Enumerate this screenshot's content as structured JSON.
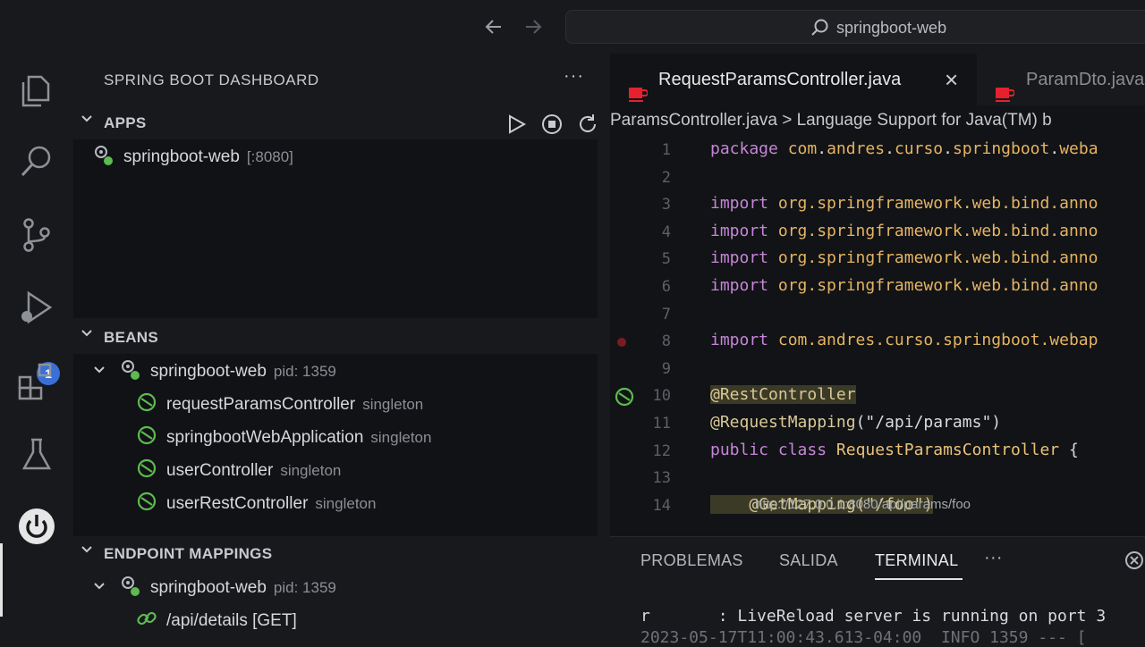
{
  "titlebar": {
    "search_text": "springboot-web",
    "back_icon": "arrow-left-icon",
    "forward_icon": "arrow-right-icon"
  },
  "activity_bar": {
    "items": [
      "files-icon",
      "search-icon",
      "source-control-icon",
      "run-debug-icon",
      "extensions-icon",
      "testing-icon",
      "spring-boot-icon"
    ],
    "debug_badge": "1"
  },
  "sidebar": {
    "title": "SPRING BOOT DASHBOARD",
    "more": "···",
    "apps": {
      "header": "APPS",
      "items": [
        {
          "name": "springboot-web",
          "port": "[:8080]"
        }
      ]
    },
    "beans": {
      "header": "BEANS",
      "app": {
        "name": "springboot-web",
        "pid": "pid: 1359"
      },
      "items": [
        {
          "name": "requestParamsController",
          "scope": "singleton"
        },
        {
          "name": "springbootWebApplication",
          "scope": "singleton"
        },
        {
          "name": "userController",
          "scope": "singleton"
        },
        {
          "name": "userRestController",
          "scope": "singleton"
        }
      ]
    },
    "endpoints": {
      "header": "ENDPOINT MAPPINGS",
      "app": {
        "name": "springboot-web",
        "pid": "pid: 1359"
      },
      "items": [
        {
          "path": "/api/details [GET]"
        }
      ]
    }
  },
  "editor": {
    "tabs": [
      {
        "label": "RequestParamsController.java",
        "close": "×"
      },
      {
        "label": "ParamDto.java"
      }
    ],
    "breadcrumb": "ParamsController.java > Language Support for Java(TM) b",
    "lines": [
      {
        "n": "1",
        "parts": [
          [
            "kw",
            "package "
          ],
          [
            "pkg",
            "com"
          ],
          [
            "str",
            "."
          ],
          [
            "pkg",
            "andres"
          ],
          [
            "str",
            "."
          ],
          [
            "pkg",
            "curso"
          ],
          [
            "str",
            "."
          ],
          [
            "pkg",
            "springboot"
          ],
          [
            "str",
            "."
          ],
          [
            "pkg",
            "weba"
          ]
        ]
      },
      {
        "n": "2",
        "parts": []
      },
      {
        "n": "3",
        "parts": [
          [
            "kw",
            "import "
          ],
          [
            "pkg",
            "org.springframework.web.bind.anno"
          ]
        ]
      },
      {
        "n": "4",
        "parts": [
          [
            "kw",
            "import "
          ],
          [
            "pkg",
            "org.springframework.web.bind.anno"
          ]
        ]
      },
      {
        "n": "5",
        "parts": [
          [
            "kw",
            "import "
          ],
          [
            "pkg",
            "org.springframework.web.bind.anno"
          ]
        ]
      },
      {
        "n": "6",
        "parts": [
          [
            "kw",
            "import "
          ],
          [
            "pkg",
            "org.springframework.web.bind.anno"
          ]
        ]
      },
      {
        "n": "7",
        "parts": []
      },
      {
        "n": "8",
        "parts": [
          [
            "kw",
            "import "
          ],
          [
            "pkg",
            "com.andres.curso.springboot.webap"
          ]
        ]
      },
      {
        "n": "9",
        "parts": []
      },
      {
        "n": "10",
        "parts": [
          [
            "ann hl",
            "@RestController"
          ]
        ]
      },
      {
        "n": "11",
        "parts": [
          [
            "ann",
            "@RequestMapping"
          ],
          [
            "str",
            "(\"/api/params\")"
          ]
        ]
      },
      {
        "n": "12",
        "parts": [
          [
            "kw",
            "public class "
          ],
          [
            "cls",
            "RequestParamsController"
          ],
          [
            "str",
            " {"
          ]
        ]
      },
      {
        "n": "13",
        "parts": []
      },
      {
        "n": "14",
        "parts": [
          [
            "ann hl",
            "    @GetMapping(\"/foo\")"
          ]
        ]
      }
    ],
    "hint": "http://127.0.0.1:8080/api/params/foo"
  },
  "panel": {
    "tabs": [
      "PROBLEMAS",
      "SALIDA",
      "TERMINAL"
    ],
    "active_tab": "TERMINAL",
    "more": "···",
    "terminal": [
      "r       : LiveReload server is running on port 3",
      "2023-05-17T11:00:43.613-04:00  INFO 1359 --- ["
    ]
  }
}
